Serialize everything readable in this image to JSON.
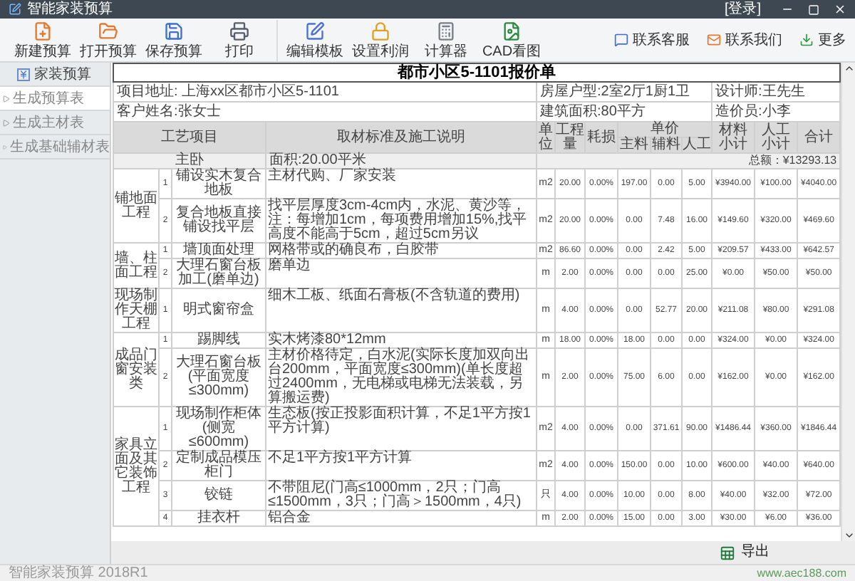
{
  "window": {
    "title": "智能家装预算",
    "login": "[登录]"
  },
  "toolbar": {
    "groups": [
      [
        {
          "label": "新建预算",
          "kind": "new"
        },
        {
          "label": "打开预算",
          "kind": "open"
        },
        {
          "label": "保存预算",
          "kind": "save"
        },
        {
          "label": "打印",
          "kind": "print"
        }
      ],
      [
        {
          "label": "编辑模板",
          "kind": "edit"
        },
        {
          "label": "设置利润",
          "kind": "lock"
        },
        {
          "label": "计算器",
          "kind": "calc"
        },
        {
          "label": "CAD看图",
          "kind": "cad"
        }
      ]
    ],
    "links": [
      {
        "label": "联系客服",
        "kind": "service"
      },
      {
        "label": "联系我们",
        "kind": "mail"
      },
      {
        "label": "更多",
        "kind": "more"
      }
    ]
  },
  "sidebar": {
    "items": [
      {
        "label": "家装预算",
        "selected": false,
        "expanded": true,
        "children": [
          {
            "label": "生成预算表",
            "selected": true
          },
          {
            "label": "生成主材表",
            "selected": false
          },
          {
            "label": "生成基础辅材表",
            "selected": false
          }
        ]
      }
    ]
  },
  "sheet": {
    "title": "都市小区5-1101报价单",
    "info": [
      [
        "项目地址: 上海xx区都市小区5-1101",
        "房屋户型:2室2厅1厨1卫",
        "设计师:王先生"
      ],
      [
        "客户姓名:张女士",
        "建筑面积:80平方",
        "造价员:小李"
      ]
    ],
    "columns": {
      "project": "工艺项目",
      "desc": "取材标准及施工说明",
      "unit": "单位",
      "qty": "工程量",
      "loss": "耗损",
      "price": "单价",
      "price_parts": [
        "主料",
        "辅料",
        "人工"
      ],
      "tail": [
        "材料小计",
        "人工小计",
        "合计"
      ]
    },
    "section": {
      "room": "主卧",
      "area": "面积:20.00平米",
      "total": "总额：¥13293.13"
    },
    "groups": [
      {
        "name": "铺地面工程",
        "items": [
          {
            "no": "1",
            "item": "铺设实木复合地板",
            "desc": "主材代购、厂家安装",
            "unit": "m2",
            "values": [
              "20.00",
              "0.00%",
              "197.00",
              "0.00",
              "5.00",
              "¥3940.00",
              "¥100.00",
              "¥4040.00"
            ]
          },
          {
            "no": "2",
            "item": "复合地板直接铺设找平层",
            "desc": "找平层厚度3cm-4cm内，水泥、黄沙等，注：每增加1cm，每项费用增加15%,找平高度不能高于5cm，超过5cm另议",
            "unit": "m2",
            "values": [
              "20.00",
              "0.00%",
              "0.00",
              "7.48",
              "16.00",
              "¥149.60",
              "¥320.00",
              "¥469.60"
            ]
          }
        ]
      },
      {
        "name": "墙、柱面工程",
        "items": [
          {
            "no": "1",
            "item": "墙顶面处理",
            "desc": "网格带或的确良布，白胶带",
            "unit": "m2",
            "values": [
              "86.60",
              "0.00%",
              "0.00",
              "2.42",
              "5.00",
              "¥209.57",
              "¥433.00",
              "¥642.57"
            ]
          },
          {
            "no": "2",
            "item": "大理石窗台板加工(磨单边)",
            "desc": "磨单边",
            "unit": "m",
            "values": [
              "2.00",
              "0.00%",
              "0.00",
              "0.00",
              "25.00",
              "¥0.00",
              "¥50.00",
              "¥50.00"
            ]
          }
        ]
      },
      {
        "name": "现场制作天棚工程",
        "items": [
          {
            "no": "1",
            "item": "明式窗帘盒",
            "desc": "细木工板、纸面石膏板(不含轨道的费用)",
            "unit": "m",
            "values": [
              "4.00",
              "0.00%",
              "0.00",
              "52.77",
              "20.00",
              "¥211.08",
              "¥80.00",
              "¥291.08"
            ]
          }
        ]
      },
      {
        "name": "成品门窗安装类",
        "items": [
          {
            "no": "1",
            "item": "踢脚线",
            "desc": "实木烤漆80*12mm",
            "unit": "m",
            "values": [
              "18.00",
              "0.00%",
              "18.00",
              "0.00",
              "0.00",
              "¥324.00",
              "¥0.00",
              "¥324.00"
            ]
          },
          {
            "no": "2",
            "item": "大理石窗台板(平面宽度≤300mm)",
            "desc": "主材价格待定，白水泥(实际长度加双向出台200mm，平面宽度≤300mm)(单长度超过2400mm，无电梯或电梯无法装载，另算搬运费)",
            "unit": "m",
            "values": [
              "2.00",
              "0.00%",
              "75.00",
              "6.00",
              "0.00",
              "¥162.00",
              "¥0.00",
              "¥162.00"
            ]
          }
        ]
      },
      {
        "name": "家具立面及其它装饰工程",
        "items": [
          {
            "no": "1",
            "item": "现场制作柜体(侧宽≤600mm)",
            "desc": "生态板(按正投影面积计算，不足1平方按1平方计算)",
            "unit": "m2",
            "values": [
              "4.00",
              "0.00%",
              "0.00",
              "371.61",
              "90.00",
              "¥1486.44",
              "¥360.00",
              "¥1846.44"
            ]
          },
          {
            "no": "2",
            "item": "定制成品模压柜门",
            "desc": "不足1平方按1平方计算",
            "unit": "m2",
            "values": [
              "4.00",
              "0.00%",
              "150.00",
              "0.00",
              "10.00",
              "¥600.00",
              "¥40.00",
              "¥640.00"
            ]
          },
          {
            "no": "3",
            "item": "铰链",
            "desc": "不带阻尼(门高≤1000mm，2只；门高≤1500mm，3只；门高＞1500mm，4只)",
            "unit": "只",
            "values": [
              "4.00",
              "0.00%",
              "10.00",
              "0.00",
              "8.00",
              "¥40.00",
              "¥32.00",
              "¥72.00"
            ]
          },
          {
            "no": "4",
            "item": "挂衣杆",
            "desc": "铝合金",
            "unit": "m",
            "values": [
              "2.00",
              "0.00%",
              "15.00",
              "0.00",
              "3.00",
              "¥30.00",
              "¥6.00",
              "¥36.00"
            ]
          }
        ]
      }
    ]
  },
  "export_button": "导出",
  "status_bar": {
    "version": "智能家装预算 2018R1",
    "site": "www.aec188.com"
  }
}
